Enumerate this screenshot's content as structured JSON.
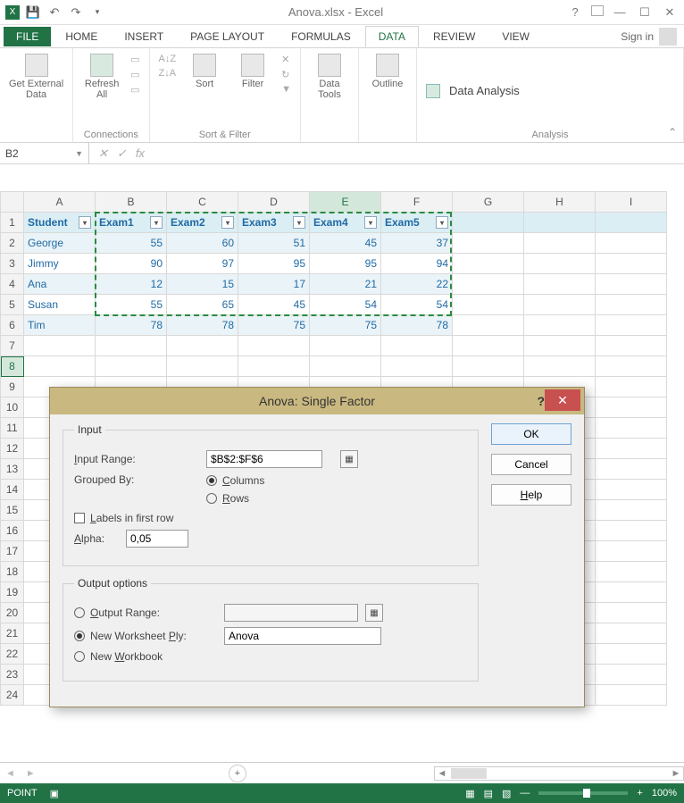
{
  "title": "Anova.xlsx - Excel",
  "tabs": {
    "file": "FILE",
    "home": "HOME",
    "insert": "INSERT",
    "pagelayout": "PAGE LAYOUT",
    "formulas": "FORMULAS",
    "data": "DATA",
    "review": "REVIEW",
    "view": "VIEW"
  },
  "signin": "Sign in",
  "ribbon": {
    "get_external": "Get External\nData",
    "refresh": "Refresh\nAll",
    "connections": "Connections",
    "sort": "Sort",
    "filter": "Filter",
    "sort_filter": "Sort & Filter",
    "data_tools": "Data\nTools",
    "outline": "Outline",
    "data_analysis": "Data Analysis",
    "analysis": "Analysis"
  },
  "namebox": "B2",
  "cols": [
    "A",
    "B",
    "C",
    "D",
    "E",
    "F",
    "G",
    "H",
    "I"
  ],
  "headers": [
    "Student",
    "Exam1",
    "Exam2",
    "Exam3",
    "Exam4",
    "Exam5"
  ],
  "rows": [
    {
      "s": "George",
      "v": [
        55,
        60,
        51,
        45,
        37
      ]
    },
    {
      "s": "Jimmy",
      "v": [
        90,
        97,
        95,
        95,
        94
      ]
    },
    {
      "s": "Ana",
      "v": [
        12,
        15,
        17,
        21,
        22
      ]
    },
    {
      "s": "Susan",
      "v": [
        55,
        65,
        45,
        54,
        54
      ]
    },
    {
      "s": "Tim",
      "v": [
        78,
        78,
        75,
        75,
        78
      ]
    }
  ],
  "dialog": {
    "title": "Anova: Single Factor",
    "input_legend": "Input",
    "input_range_label": "Input Range:",
    "input_range_value": "$B$2:$F$6",
    "grouped_by": "Grouped By:",
    "columns": "Columns",
    "rows_opt": "Rows",
    "labels_first_row": "Labels in first row",
    "alpha_label": "Alpha:",
    "alpha_value": "0,05",
    "output_legend": "Output options",
    "output_range": "Output Range:",
    "new_ws_ply": "New Worksheet Ply:",
    "new_ws_value": "Anova",
    "new_workbook": "New Workbook",
    "ok": "OK",
    "cancel": "Cancel",
    "help": "Help"
  },
  "status": {
    "mode": "POINT",
    "zoom": "100%"
  }
}
